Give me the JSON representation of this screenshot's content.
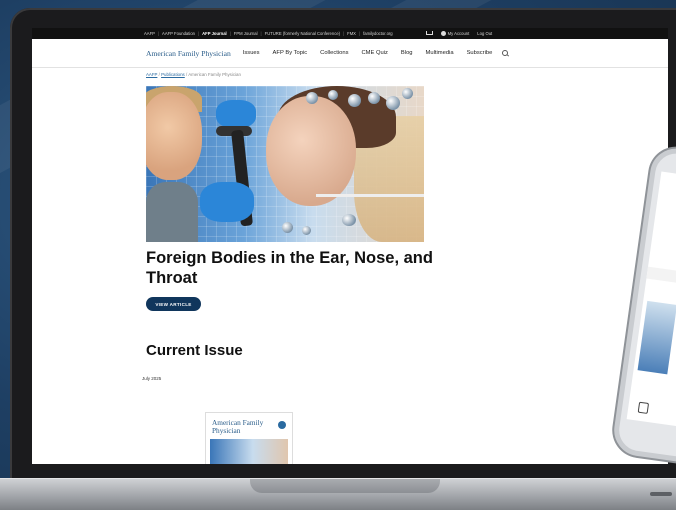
{
  "utility_bar": {
    "items": [
      "AAFP",
      "AAFP Foundation",
      "AFP Journal",
      "FPM Journal",
      "FUTURE (formerly National Conference)",
      "FMX",
      "familydoctor.org"
    ],
    "active_index": 2,
    "account_label": "My Account",
    "logout_label": "Log Out"
  },
  "nav": {
    "brand": "American Family Physician",
    "items": [
      "Issues",
      "AFP By Topic",
      "Collections",
      "CME Quiz",
      "Blog",
      "Multimedia",
      "Subscribe"
    ]
  },
  "breadcrumb": {
    "link1": "AAFP",
    "link2": "Publications",
    "current": "American Family Physician"
  },
  "hero": {
    "title": "Foreign Bodies in the Ear, Nose, and Throat",
    "button_label": "VIEW ARTICLE"
  },
  "current_issue": {
    "heading": "Current Issue",
    "date": "July 2025",
    "cover_title": "American Family Physician"
  },
  "colors": {
    "brand_blue": "#2a5d8a",
    "button_navy": "#10365c",
    "utility_bg": "#111111"
  }
}
